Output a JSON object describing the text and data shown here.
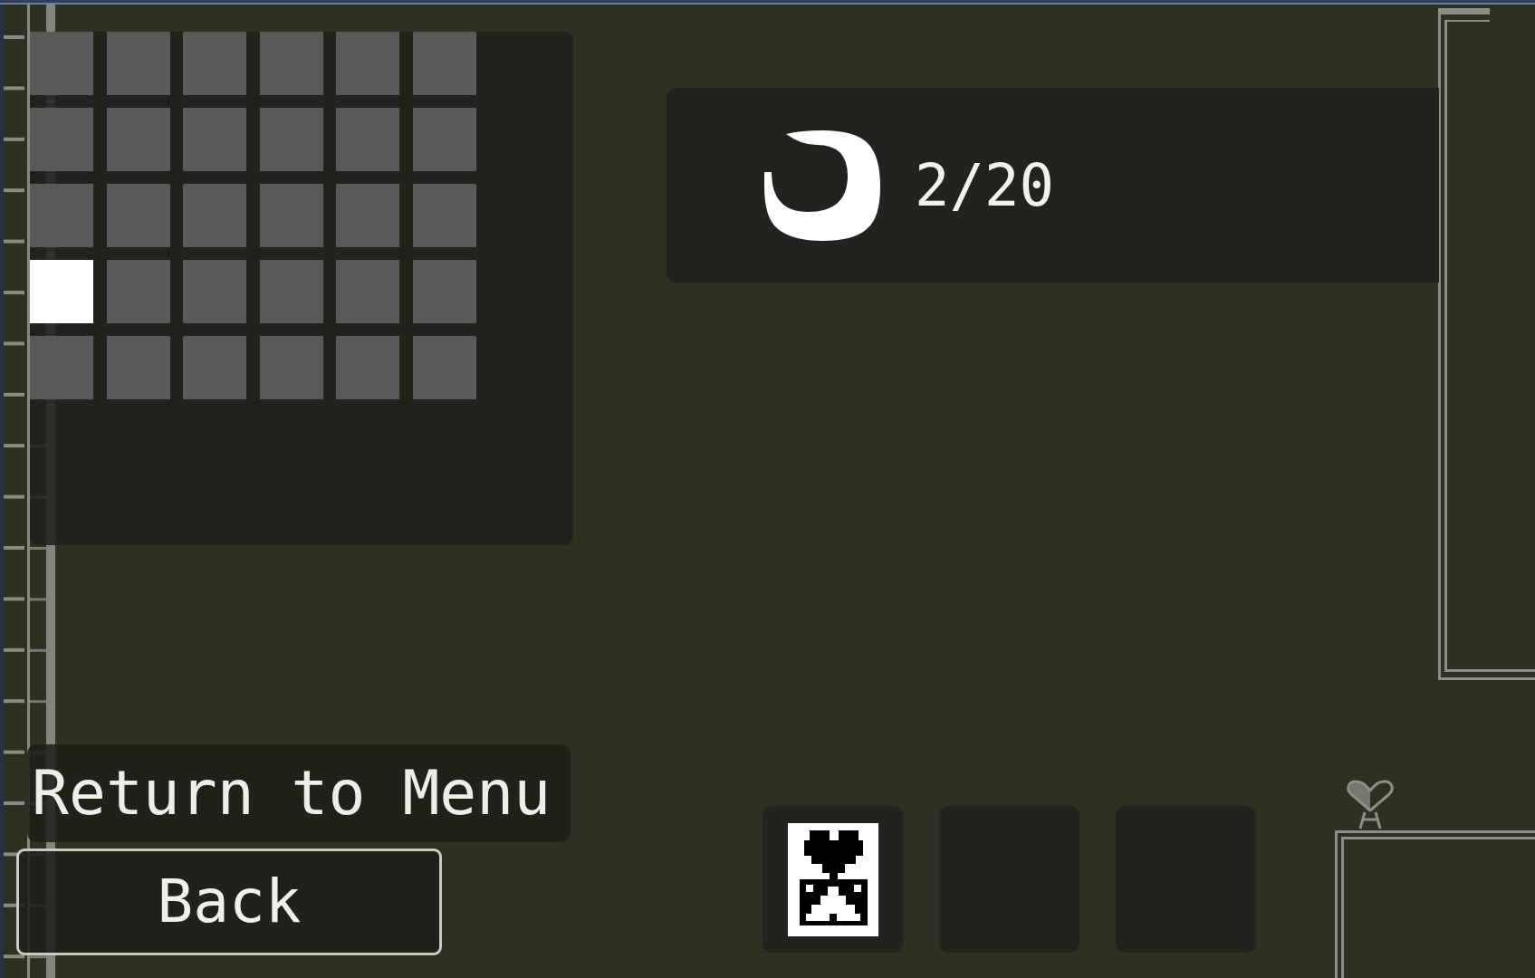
{
  "level_grid": {
    "rows": [
      [
        {
          "selected": false
        },
        {
          "selected": false
        },
        {
          "selected": false
        },
        {
          "selected": false
        },
        {
          "selected": false
        },
        {
          "selected": false
        }
      ],
      [
        {
          "selected": false
        },
        {
          "selected": false
        },
        {
          "selected": false
        },
        {
          "selected": false
        },
        {
          "selected": false
        },
        {
          "selected": false
        }
      ],
      [
        {
          "selected": false
        },
        {
          "selected": false
        },
        {
          "selected": false
        },
        {
          "selected": false
        },
        {
          "selected": false
        },
        {
          "selected": false
        }
      ],
      [
        {
          "selected": true
        },
        {
          "selected": false
        },
        {
          "selected": false
        },
        {
          "selected": false
        },
        {
          "selected": false
        },
        {
          "selected": false
        }
      ],
      [
        {
          "selected": false
        },
        {
          "selected": false
        },
        {
          "selected": false
        },
        {
          "selected": false
        },
        {
          "selected": false
        },
        {
          "selected": false
        }
      ]
    ]
  },
  "counter": {
    "text": "2/20"
  },
  "menu": {
    "return_button": "Return to Menu",
    "back_button": "Back"
  },
  "item_slots": [
    {
      "kind": "card"
    },
    {
      "kind": "empty"
    },
    {
      "kind": "empty"
    }
  ]
}
